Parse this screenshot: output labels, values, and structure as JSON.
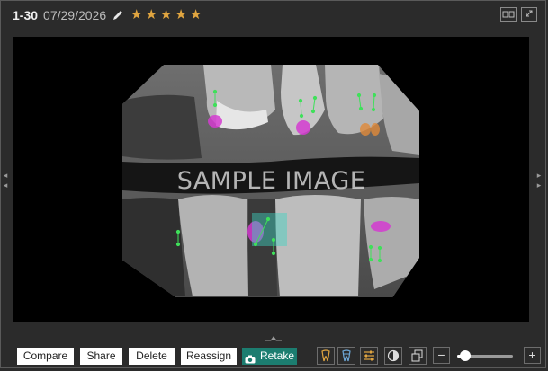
{
  "header": {
    "id": "1-30",
    "date": "07/29/2026",
    "rating": 5,
    "rating_max": 5
  },
  "viewer": {
    "watermark": "SAMPLE IMAGE"
  },
  "toolbar": {
    "compare_label": "Compare",
    "share_label": "Share",
    "delete_label": "Delete",
    "reassign_label": "Reassign",
    "retake_label": "Retake",
    "zoom_level": 0.15
  },
  "colors": {
    "accent": "#1c7d70",
    "star": "#e0a540",
    "annotation_magenta": "#d43bd0",
    "annotation_orange": "#e08a3a",
    "annotation_point": "#3fe05a",
    "annotation_box": "#3fd2c0"
  },
  "icons": [
    "edit-pencil-icon",
    "star-icon",
    "split-view-icon",
    "expand-icon",
    "camera-icon",
    "tooth-orange-icon",
    "tooth-blue-icon",
    "sliders-icon",
    "contrast-icon",
    "copy-icon",
    "zoom-out-icon",
    "zoom-in-icon"
  ]
}
